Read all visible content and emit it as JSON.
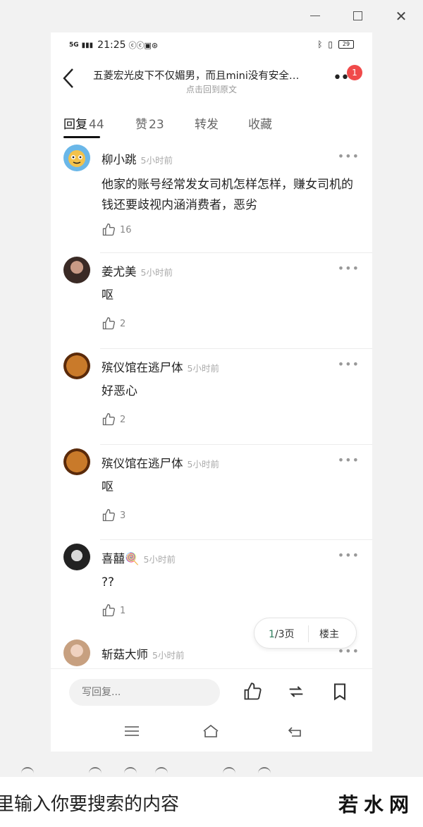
{
  "window": {
    "minimize_icon": "minimize-icon",
    "maximize_icon": "maximize-icon",
    "close_glyph": "✕"
  },
  "status_bar": {
    "signal": "5G",
    "time": "21:25",
    "battery": "29"
  },
  "header": {
    "title": "五菱宏光皮下不仅媚男，而且mini没有安全…",
    "subtitle": "点击回到原文",
    "notification_count": "1"
  },
  "tabs": [
    {
      "label": "回复",
      "count": "44",
      "active": true
    },
    {
      "label": "赞",
      "count": "23",
      "active": false
    },
    {
      "label": "转发",
      "count": "",
      "active": false
    },
    {
      "label": "收藏",
      "count": "",
      "active": false
    }
  ],
  "comments": [
    {
      "user": "柳小跳",
      "time": "5小时前",
      "text": "他家的账号经常发女司机怎样怎样，赚女司机的钱还要歧视内涵消费者，恶劣",
      "likes": "16",
      "avatar": "cartoon-avatar"
    },
    {
      "user": "姜尤美",
      "time": "5小时前",
      "text": "呕",
      "likes": "2",
      "avatar": "woman-avatar"
    },
    {
      "user": "殡仪馆在逃尸体",
      "time": "5小时前",
      "text": "好恶心",
      "likes": "2",
      "avatar": "orange-avatar"
    },
    {
      "user": "殡仪馆在逃尸体",
      "time": "5小时前",
      "text": "呕",
      "likes": "3",
      "avatar": "orange-avatar"
    },
    {
      "user": "喜囍🍭",
      "time": "5小时前",
      "text": "??",
      "likes": "1",
      "avatar": "dark-avatar"
    },
    {
      "user": "斩菇大师",
      "time": "5小时前",
      "text": "",
      "likes": "",
      "avatar": "girl-avatar"
    }
  ],
  "pager": {
    "current": "1",
    "total_label": "/3页",
    "owner_label": "楼主"
  },
  "bottom_bar": {
    "reply_placeholder": "写回复..."
  },
  "search": {
    "text": "里输入你要搜索的内容"
  },
  "brand": {
    "logo_text": "若水网"
  }
}
